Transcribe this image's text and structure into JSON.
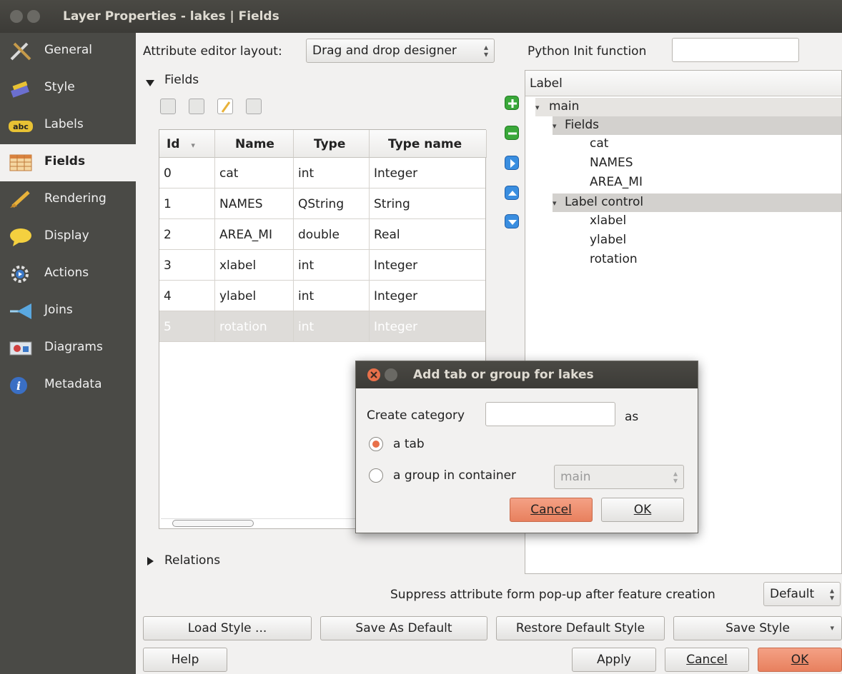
{
  "window": {
    "title": "Layer Properties - lakes | Fields"
  },
  "sidebar": {
    "items": [
      {
        "label": "General",
        "icon": "tools-icon"
      },
      {
        "label": "Style",
        "icon": "brush-icon"
      },
      {
        "label": "Labels",
        "icon": "abc-icon"
      },
      {
        "label": "Fields",
        "icon": "table-icon",
        "selected": true
      },
      {
        "label": "Rendering",
        "icon": "paintbrush-icon"
      },
      {
        "label": "Display",
        "icon": "speech-bubble-icon"
      },
      {
        "label": "Actions",
        "icon": "gear-icon"
      },
      {
        "label": "Joins",
        "icon": "join-arrow-icon"
      },
      {
        "label": "Diagrams",
        "icon": "diagram-icon"
      },
      {
        "label": "Metadata",
        "icon": "info-icon"
      }
    ]
  },
  "fields_page": {
    "layout_label": "Attribute editor layout:",
    "layout_value": "Drag and drop designer",
    "python_init_label": "Python Init function",
    "python_init_value": "",
    "fields_section": "Fields",
    "relations_section": "Relations",
    "table": {
      "columns": [
        "Id",
        "Name",
        "Type",
        "Type name"
      ],
      "rows": [
        [
          "0",
          "cat",
          "int",
          "Integer"
        ],
        [
          "1",
          "NAMES",
          "QString",
          "String"
        ],
        [
          "2",
          "AREA_MI",
          "double",
          "Real"
        ],
        [
          "3",
          "xlabel",
          "int",
          "Integer"
        ],
        [
          "4",
          "ylabel",
          "int",
          "Integer"
        ],
        [
          "5",
          "rotation",
          "int",
          "Integer"
        ]
      ],
      "selected_row": 5
    },
    "tree": {
      "header": "Label",
      "nodes": [
        "main",
        "Fields",
        "cat",
        "NAMES",
        "AREA_MI",
        "Label control",
        "xlabel",
        "ylabel",
        "rotation"
      ]
    },
    "suppress_label": "Suppress attribute form pop-up after feature creation",
    "suppress_value": "Default"
  },
  "dialog": {
    "title": "Add tab or group for lakes",
    "create_category_label": "Create category",
    "create_category_value": "",
    "as_label": "as",
    "option_tab": "a tab",
    "option_group": "a group in container",
    "container_value": "main",
    "cancel_label": "Cancel",
    "ok_label": "OK"
  },
  "footer": {
    "load_style": "Load Style ...",
    "save_as_default": "Save As Default",
    "restore_default": "Restore Default Style",
    "save_style": "Save Style",
    "help": "Help",
    "apply": "Apply",
    "cancel": "Cancel",
    "ok": "OK"
  },
  "colors": {
    "accent": "#e8704a",
    "sidebar_bg": "#4a4a46",
    "titlebar_bg": "#3c3b37"
  }
}
